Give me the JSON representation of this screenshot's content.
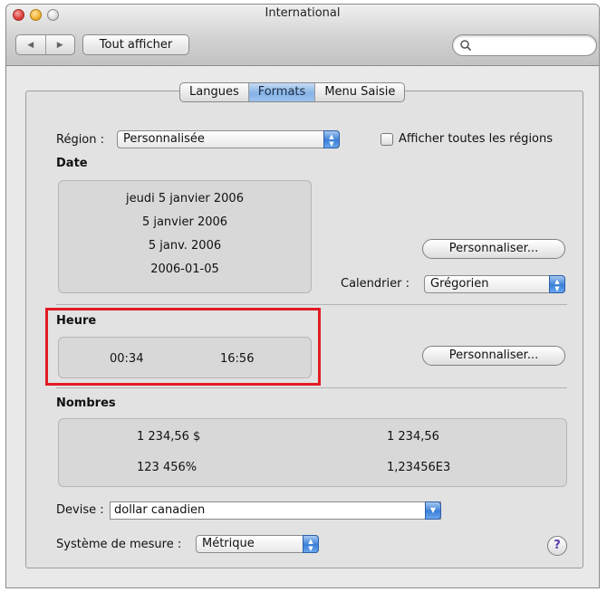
{
  "window": {
    "title": "International"
  },
  "toolbar": {
    "show_all_label": "Tout afficher",
    "search_placeholder": ""
  },
  "tabs": [
    {
      "label": "Langues",
      "active": false
    },
    {
      "label": "Formats",
      "active": true
    },
    {
      "label": "Menu Saisie",
      "active": false
    }
  ],
  "region": {
    "label": "Région :",
    "value": "Personnalisée",
    "show_all_label": "Afficher toutes les régions",
    "show_all_checked": false
  },
  "date": {
    "heading": "Date",
    "samples": [
      "jeudi 5 janvier 2006",
      "5 janvier 2006",
      "5 janv. 2006",
      "2006-01-05"
    ],
    "customize_label": "Personnaliser...",
    "calendar_label": "Calendrier :",
    "calendar_value": "Grégorien"
  },
  "time": {
    "heading": "Heure",
    "samples": [
      "00:34",
      "16:56"
    ],
    "customize_label": "Personnaliser..."
  },
  "numbers": {
    "heading": "Nombres",
    "samples": [
      "1 234,56 $",
      "1 234,56",
      "123 456%",
      "1,23456E3"
    ]
  },
  "currency": {
    "label": "Devise :",
    "value": "dollar canadien"
  },
  "measure": {
    "label": "Système de mesure :",
    "value": "Métrique"
  },
  "help_label": "?",
  "colors": {
    "highlight": "#e21b23",
    "accent": "#3a7fd8"
  }
}
